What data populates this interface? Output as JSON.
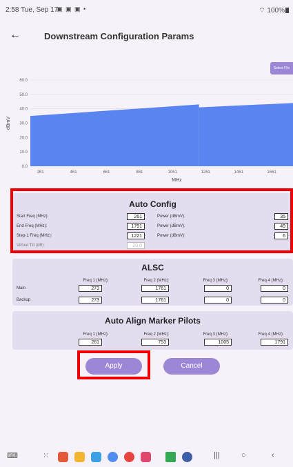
{
  "status_bar": {
    "time": "2:58",
    "date": "Tue, Sep 17",
    "battery": "100%"
  },
  "app_bar": {
    "title": "Downstream Configuration Params"
  },
  "select_file_label": "Select File",
  "chart_data": {
    "type": "area",
    "title": "",
    "xlabel": "MHz",
    "ylabel": "dBmV",
    "x_ticks": [
      "261",
      "461",
      "661",
      "861",
      "1061",
      "1261",
      "1461",
      "1661"
    ],
    "y_ticks": [
      "0.0",
      "10.0",
      "20.0",
      "30.0",
      "40.0",
      "50.0",
      "60.0"
    ],
    "xlim": [
      200,
      1790
    ],
    "ylim": [
      0,
      60
    ],
    "grid": true,
    "color": "#5a84f0",
    "segments": [
      {
        "x": [
          200,
          1221
        ],
        "y": [
          35,
          43
        ]
      },
      {
        "x": [
          1221,
          1790
        ],
        "y": [
          41,
          44
        ]
      }
    ]
  },
  "auto_config": {
    "title": "Auto Config",
    "start_freq_label": "Start Freq (MHz):",
    "start_freq": "261",
    "end_freq_label": "End Freq (MHz):",
    "end_freq": "1791",
    "step_freq_label": "Step-1 Freq (MHz):",
    "step_freq": "1221",
    "virtual_tilt_label": "Virtual Tilt (dB):",
    "virtual_tilt": "20.0",
    "power_label": "Power (dBmV):",
    "power_1": "35",
    "power_2": "49",
    "power_3": "6"
  },
  "alsc": {
    "title": "ALSC",
    "headers": [
      "Freq 1 (MHz):",
      "Freq 2 (MHz):",
      "Freq 3 (MHz):",
      "Freq 4 (MHz):"
    ],
    "rows": [
      {
        "label": "Main",
        "values": [
          "273",
          "1761",
          "0",
          "0"
        ]
      },
      {
        "label": "Backup",
        "values": [
          "273",
          "1761",
          "0",
          "0"
        ]
      }
    ]
  },
  "pilots": {
    "title": "Auto Align Marker Pilots",
    "headers": [
      "Freq 1 (MHz):",
      "Freq 2 (MHz):",
      "Freq 3 (MHz):",
      "Freq 4 (MHz):"
    ],
    "values": [
      "261",
      "753",
      "1005",
      "1791"
    ]
  },
  "buttons": {
    "apply": "Apply",
    "cancel": "Cancel"
  },
  "nav_bar": {
    "recents": "|||",
    "home": "○",
    "back": "‹"
  },
  "colors": {
    "accent": "#9b87d6",
    "section": "#e4ddf0",
    "highlight": "#ee0000",
    "chart_fill": "#5a84f0"
  }
}
